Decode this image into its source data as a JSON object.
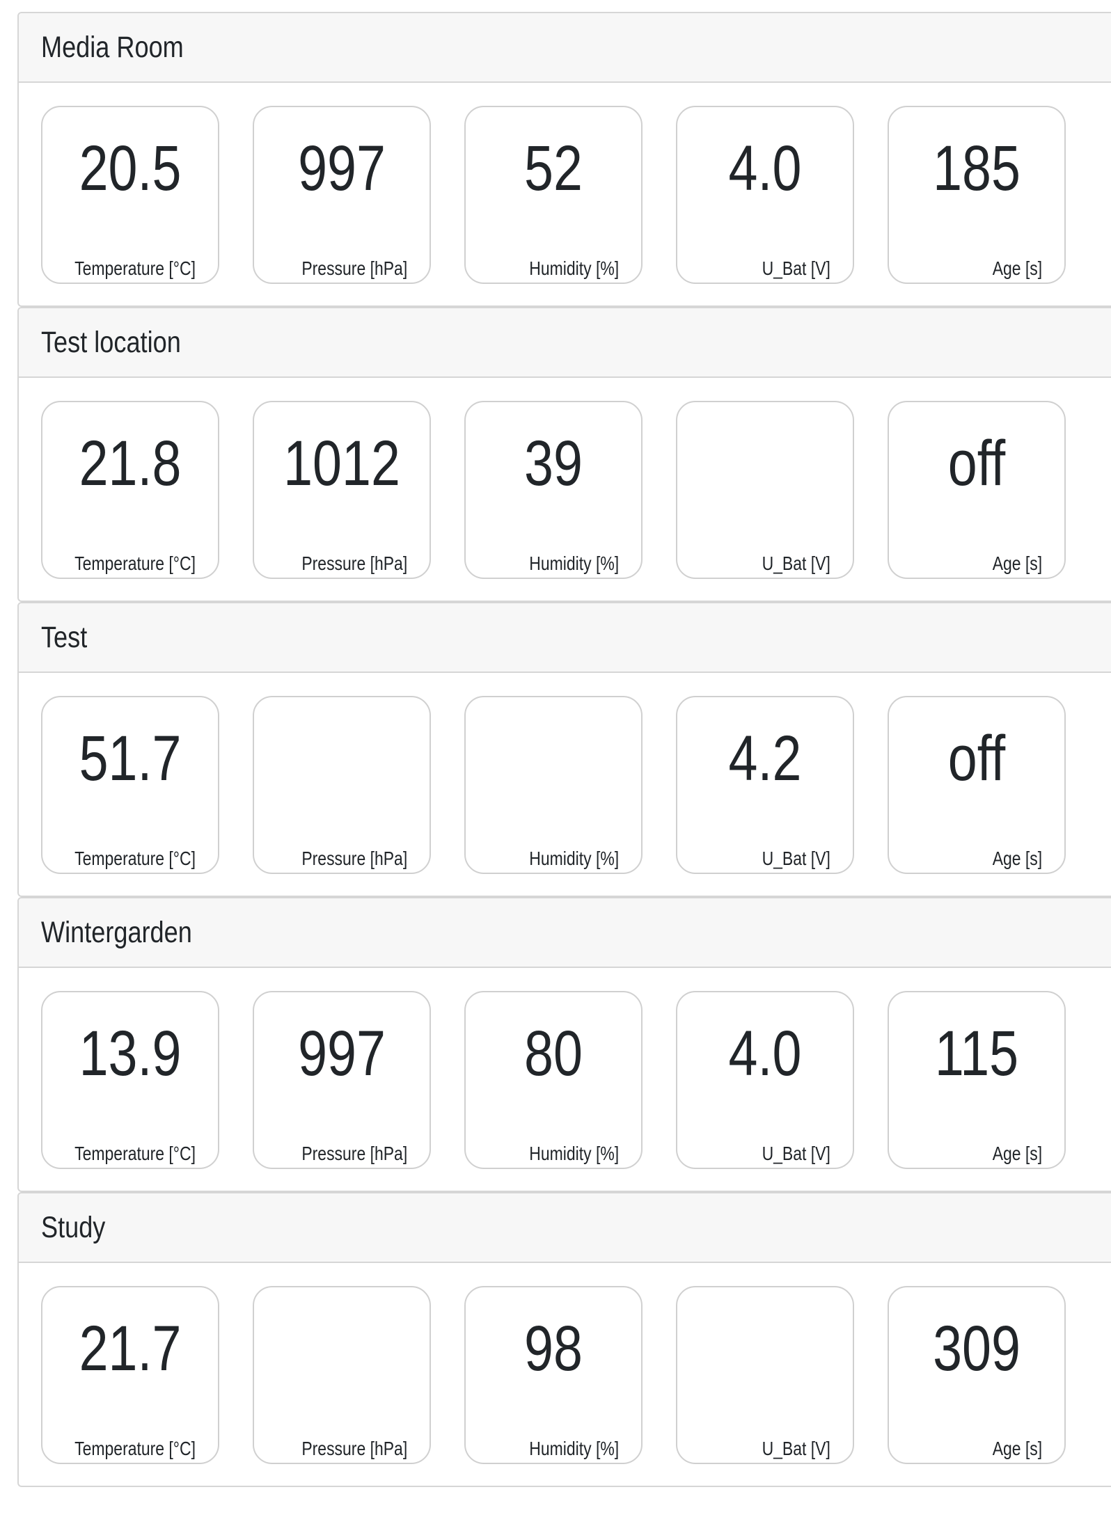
{
  "rooms": [
    {
      "name": "Media Room",
      "metrics": [
        {
          "label": "Temperature [°C]",
          "value": "20.5"
        },
        {
          "label": "Pressure [hPa]",
          "value": "997"
        },
        {
          "label": "Humidity [%]",
          "value": "52"
        },
        {
          "label": "U_Bat [V]",
          "value": "4.0"
        },
        {
          "label": "Age [s]",
          "value": "185"
        }
      ]
    },
    {
      "name": "Test location",
      "metrics": [
        {
          "label": "Temperature [°C]",
          "value": "21.8"
        },
        {
          "label": "Pressure [hPa]",
          "value": "1012"
        },
        {
          "label": "Humidity [%]",
          "value": "39"
        },
        {
          "label": "U_Bat [V]",
          "value": ""
        },
        {
          "label": "Age [s]",
          "value": "off"
        }
      ]
    },
    {
      "name": "Test",
      "metrics": [
        {
          "label": "Temperature [°C]",
          "value": "51.7"
        },
        {
          "label": "Pressure [hPa]",
          "value": ""
        },
        {
          "label": "Humidity [%]",
          "value": ""
        },
        {
          "label": "U_Bat [V]",
          "value": "4.2"
        },
        {
          "label": "Age [s]",
          "value": "off"
        }
      ]
    },
    {
      "name": "Wintergarden",
      "metrics": [
        {
          "label": "Temperature [°C]",
          "value": "13.9"
        },
        {
          "label": "Pressure [hPa]",
          "value": "997"
        },
        {
          "label": "Humidity [%]",
          "value": "80"
        },
        {
          "label": "U_Bat [V]",
          "value": "4.0"
        },
        {
          "label": "Age [s]",
          "value": "115"
        }
      ]
    },
    {
      "name": "Study",
      "metrics": [
        {
          "label": "Temperature [°C]",
          "value": "21.7"
        },
        {
          "label": "Pressure [hPa]",
          "value": ""
        },
        {
          "label": "Humidity [%]",
          "value": "98"
        },
        {
          "label": "U_Bat [V]",
          "value": ""
        },
        {
          "label": "Age [s]",
          "value": "309"
        }
      ]
    }
  ]
}
